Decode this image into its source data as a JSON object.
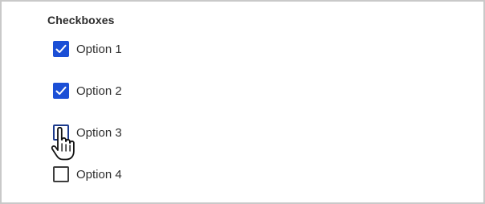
{
  "group": {
    "title": "Checkboxes"
  },
  "options": [
    {
      "label": "Option 1",
      "checked": true
    },
    {
      "label": "Option 2",
      "checked": true
    },
    {
      "label": "Option 3",
      "checked": false,
      "hovered": true
    },
    {
      "label": "Option 4",
      "checked": false
    }
  ],
  "colors": {
    "accent": "#1b4fd6",
    "border": "#3d3d3d",
    "text": "#2e2e2e"
  },
  "cursor": {
    "icon": "pointer-hand-icon"
  }
}
